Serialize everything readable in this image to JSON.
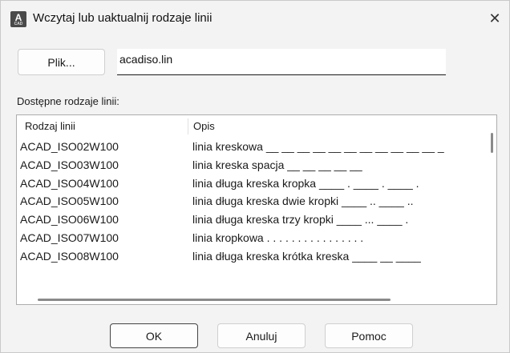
{
  "window": {
    "title": "Wczytaj lub uaktualnij rodzaje linii",
    "icon_letter": "A",
    "icon_sub": "CAD",
    "close_glyph": "✕"
  },
  "file": {
    "button_label": "Plik...",
    "input_value": "acadiso.lin"
  },
  "list": {
    "label": "Dostępne rodzaje linii:",
    "columns": [
      "Rodzaj linii",
      "Opis"
    ],
    "rows": [
      {
        "name": "ACAD_ISO02W100",
        "desc": "linia kreskowa __ __ __ __ __ __ __ __ __ __ __ _"
      },
      {
        "name": "ACAD_ISO03W100",
        "desc": "linia kreska spacja __     __     __     __     __"
      },
      {
        "name": "ACAD_ISO04W100",
        "desc": "linia długa kreska kropka ____ . ____ . ____ ."
      },
      {
        "name": "ACAD_ISO05W100",
        "desc": "linia długa kreska dwie kropki ____ .. ____ .."
      },
      {
        "name": "ACAD_ISO06W100",
        "desc": "linia długa kreska trzy kropki ____ ... ____ ."
      },
      {
        "name": "ACAD_ISO07W100",
        "desc": "linia kropkowa . . . . . . . . . . . . . . . ."
      },
      {
        "name": "ACAD_ISO08W100",
        "desc": "linia długa kreska krótka kreska ____ __ ____"
      }
    ]
  },
  "buttons": {
    "ok": "OK",
    "cancel": "Anuluj",
    "help": "Pomoc"
  }
}
